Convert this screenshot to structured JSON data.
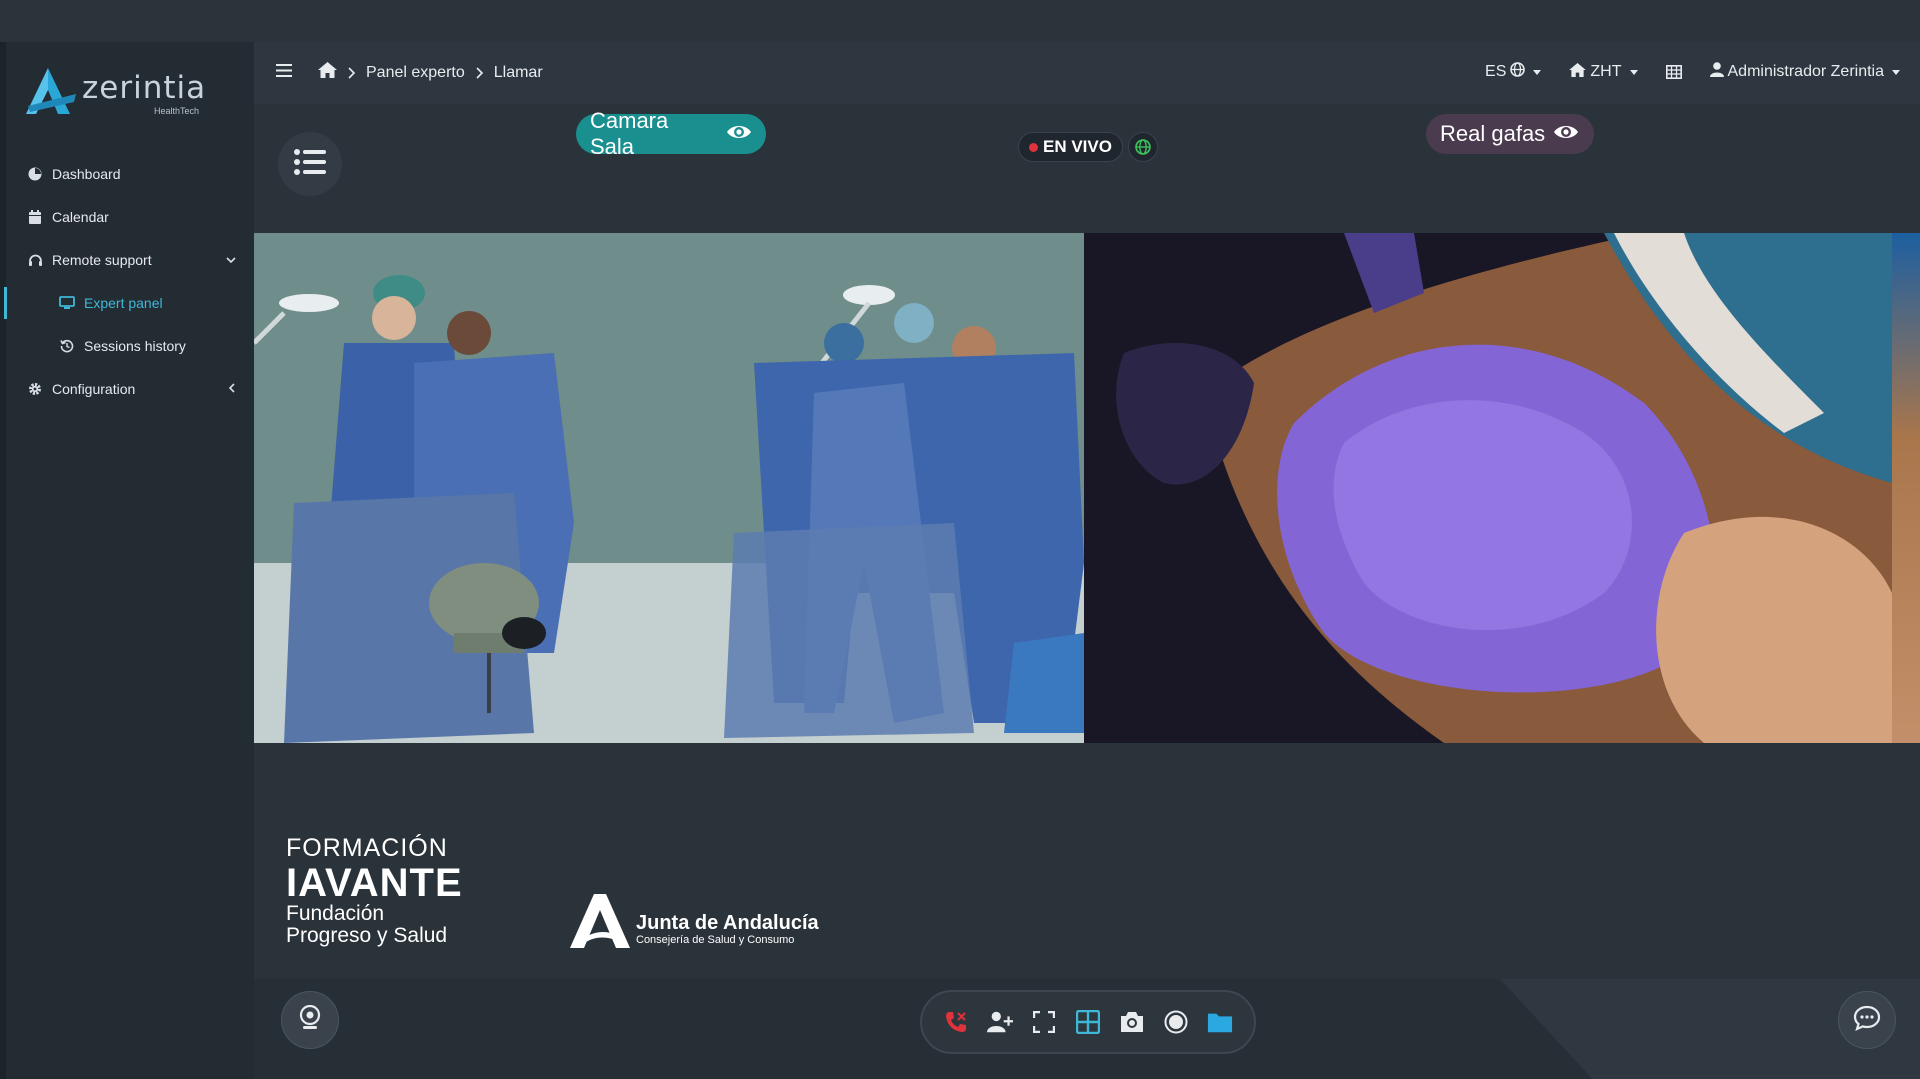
{
  "app": {
    "logo_name": "zerintia",
    "logo_sub": "HealthTech"
  },
  "sidebar": {
    "items": [
      {
        "label": "Dashboard",
        "icon": "dashboard-icon"
      },
      {
        "label": "Calendar",
        "icon": "calendar-icon"
      },
      {
        "label": "Remote support",
        "icon": "headset-icon",
        "expanded": true
      },
      {
        "label": "Expert panel",
        "icon": "monitor-icon",
        "active": true
      },
      {
        "label": "Sessions history",
        "icon": "history-icon"
      },
      {
        "label": "Configuration",
        "icon": "gear-icon",
        "expanded": false
      }
    ]
  },
  "header": {
    "breadcrumb": [
      "Panel experto",
      "Llamar"
    ],
    "language": "ES",
    "site": "ZHT",
    "user": "Administrador Zerintia"
  },
  "streams": {
    "left_label": "Camara Sala",
    "right_label": "Real gafas",
    "live_label": "EN VIVO"
  },
  "branding": {
    "iavante_line1": "FORMACIÓN",
    "iavante_line2": "IAVANTE",
    "iavante_line3": "Fundación",
    "iavante_line4": "Progreso y Salud",
    "junta_title": "Junta de Andalucía",
    "junta_sub": "Consejería de Salud y Consumo"
  },
  "colors": {
    "accent": "#3fb8d8",
    "sala_pill": "#1a8f8f",
    "gafas_pill": "#4a3b4e",
    "live_dot": "#e0323a",
    "hangup": "#e0323a",
    "folder": "#29a9e0"
  }
}
